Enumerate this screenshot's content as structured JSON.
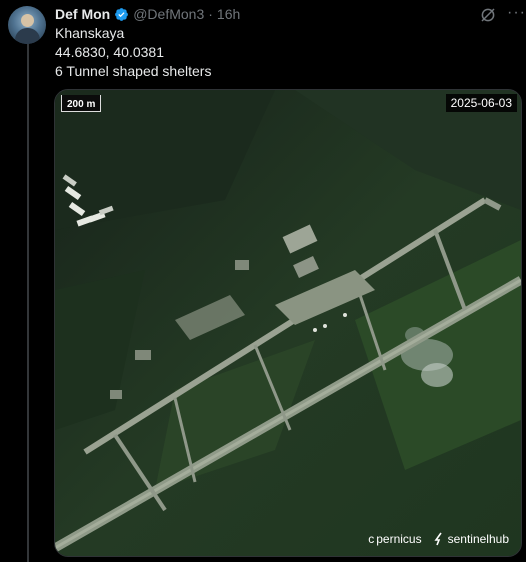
{
  "tweet": {
    "display_name": "Def Mon",
    "handle": "@DefMon3",
    "separator": "·",
    "time": "16h",
    "lines": [
      "Khanskaya",
      "44.6830, 40.0381",
      "6 Tunnel shaped shelters"
    ]
  },
  "media": {
    "scale_label": "200 m",
    "date_label": "2025-06-03",
    "credit_copernicus": "c",
    "credit_copernicus_rest": "pernicus",
    "credit_sentinel": "sentinelhub"
  },
  "colors": {
    "accent_verified": "#1d9bf0",
    "muted_text": "#71767b"
  }
}
